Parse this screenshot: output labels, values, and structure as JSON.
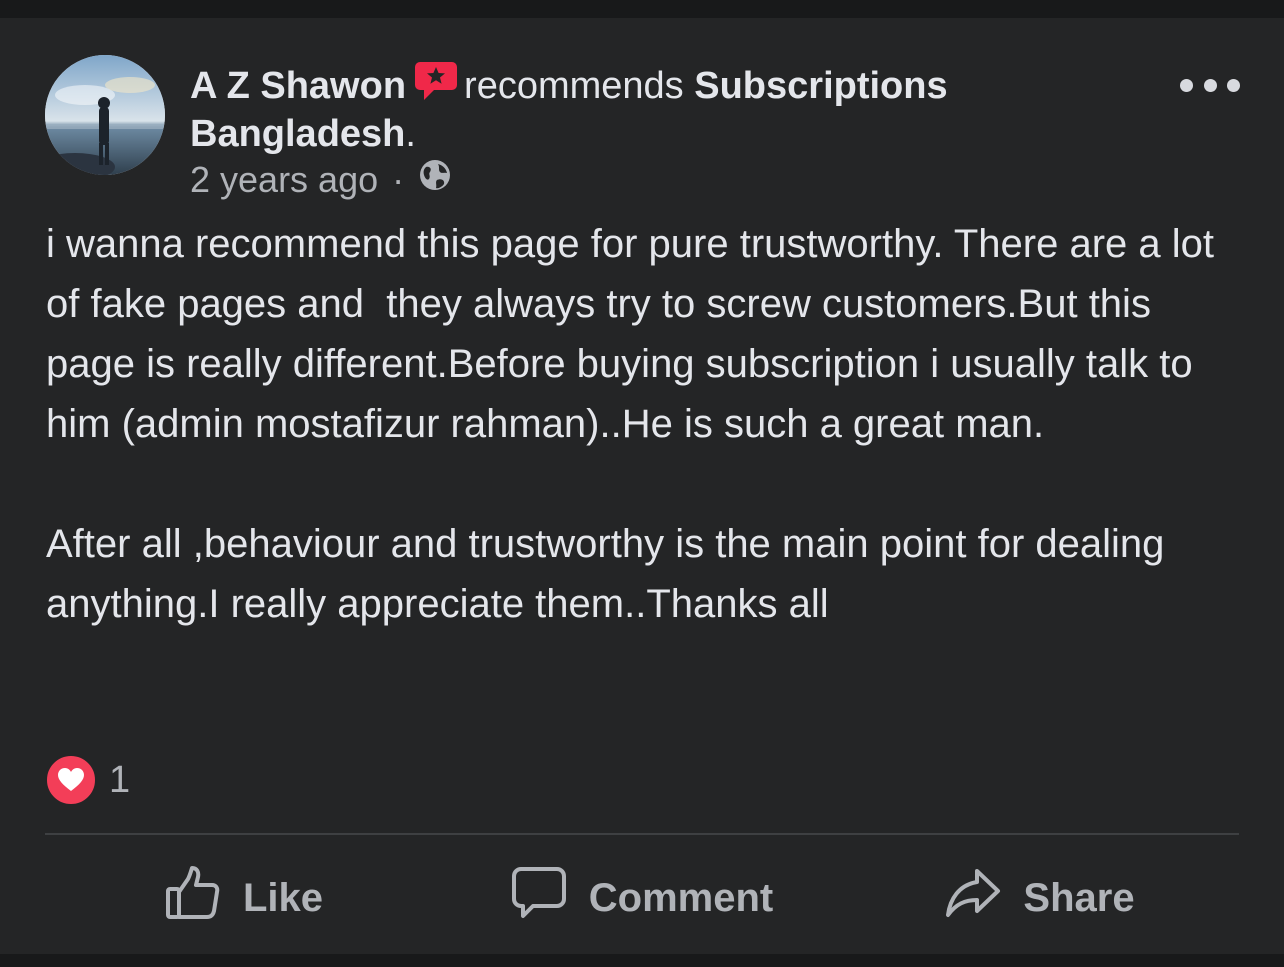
{
  "post": {
    "author": "A Z Shawon",
    "recommends_text": "recommends",
    "page_name": "Subscriptions Bangladesh",
    "period": ".",
    "time": "2 years ago",
    "separator": "·",
    "privacy_icon": "globe-icon",
    "body": "i wanna recommend this page for pure trustworthy. There are a lot of fake pages and  they always try to screw customers.But this page is really different.Before buying subscription i usually talk to him (admin mostafizur rahman)..He is such a great man.\n\nAfter all ,behaviour and trustworthy is the main point for dealing anything.I really appreciate them..Thanks all",
    "reaction_count": "1",
    "reaction_icon": "love-reaction-icon"
  },
  "actions": {
    "like": "Like",
    "comment": "Comment",
    "share": "Share"
  },
  "colors": {
    "background": "#242526",
    "text": "#e4e6eb",
    "secondary_text": "#b0b3b8",
    "recommend_badge": "#f02849",
    "love": "#f33e58"
  }
}
